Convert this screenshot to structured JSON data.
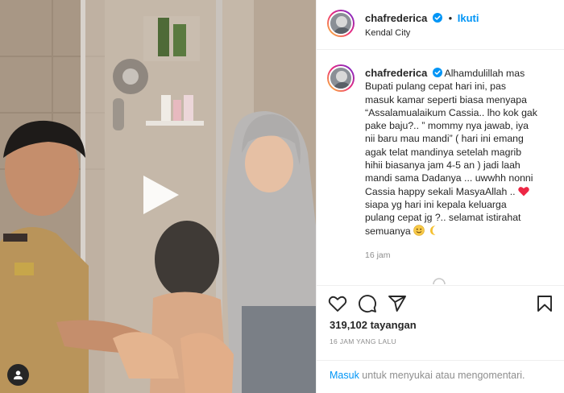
{
  "post": {
    "username": "chafrederica",
    "follow_label": "Ikuti",
    "separator": "•",
    "location": "Kendal City"
  },
  "caption": {
    "username": "chafrederica",
    "lines": [
      "Alhamdulillah mas",
      "Bupati pulang cepat hari ini, pas",
      "masuk kamar seperti biasa menyapa",
      "“Assalamualaikum Cassia.. lho kok gak",
      "pake baju?.. ” mommy nya jawab, iya",
      "nii baru mau mandi” ( hari ini emang",
      "agak telat mandinya setelah magrib",
      "hihii biasanya jam 4-5 an ) jadi laah",
      "mandi sama Dadanya ... uwwhh nonni",
      "Cassia happy sekali MasyaAllah ..",
      "siapa yg hari ini kepala keluarga",
      "pulang cepat jg ?.. selamat istirahat",
      "semuanya"
    ],
    "time": "16 jam"
  },
  "stats": {
    "views": "319,102 tayangan",
    "time_ago": "16 JAM YANG LALU"
  },
  "login": {
    "link": "Masuk",
    "text": " untuk menyukai atau mengomentari."
  },
  "icons": {
    "verified": "verified-badge-icon",
    "heart": "heart-icon",
    "comment": "comment-icon",
    "share": "share-icon",
    "save": "bookmark-icon",
    "play": "play-icon",
    "user": "user-icon"
  },
  "colors": {
    "accent": "#0095f6",
    "text": "#262626",
    "muted": "#8e8e8e",
    "border": "#efefef",
    "emoji_heart": "#ed2745"
  }
}
